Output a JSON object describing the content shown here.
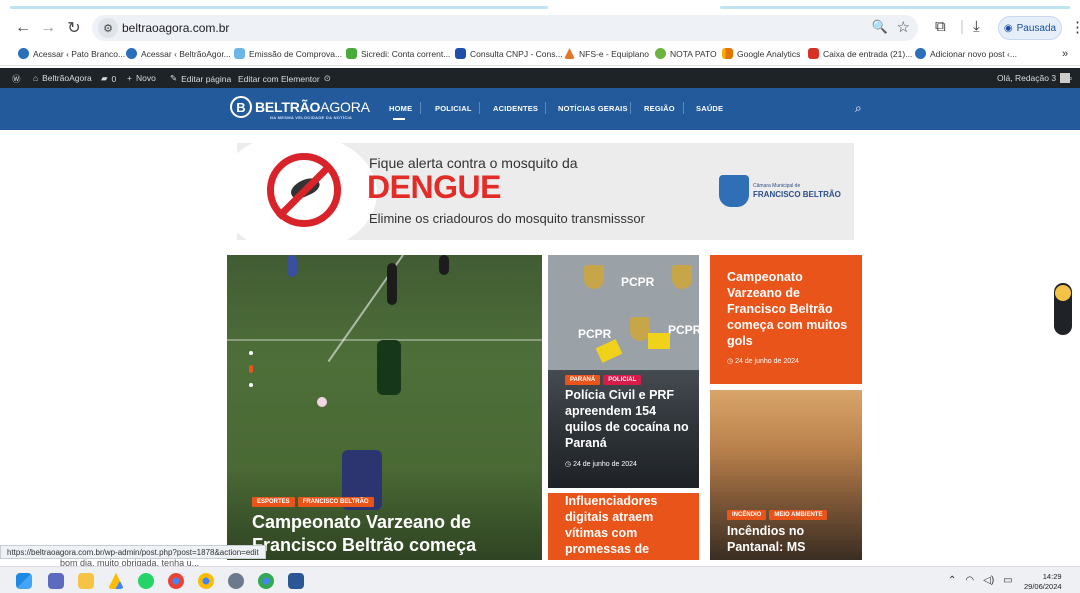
{
  "browser": {
    "url": "beltraoagora.com.br",
    "profile_label": "Pausada",
    "bookmarks": [
      "Acessar ‹ Pato Branco...",
      "Acessar ‹ BeltrãoAgor...",
      "Emissão de Comprova...",
      "Sicredi: Conta corrent...",
      "Consulta CNPJ - Cons...",
      "NFS-e - Equiplano",
      "NOTA PATO",
      "Google Analytics",
      "Caixa de entrada (21)...",
      "Adicionar novo post ‹..."
    ],
    "more_bookmarks": "»"
  },
  "wpbar": {
    "site_name": "BeltrãoAgora",
    "comments_count": "0",
    "new_label": "Novo",
    "edit_page": "Editar página",
    "edit_elementor": "Editar com Elementor",
    "greeting": "Olá, Redação 3"
  },
  "site": {
    "logo_main": "BELTRÃO",
    "logo_second": "AGORA",
    "logo_tagline": "NA MESMA VELOCIDADE DA NOTÍCIA",
    "nav": [
      "HOME",
      "POLICIAL",
      "ACIDENTES",
      "NOTÍCIAS GERAIS",
      "REGIÃO",
      "SAÚDE"
    ]
  },
  "banner": {
    "line1": "Fique alerta contra o mosquito da",
    "line2": "DENGUE",
    "line3": "Elimine os criadouros do mosquito transmisssor",
    "seal_small": "Câmara Municipal de",
    "seal_big": "FRANCISCO BELTRÃO"
  },
  "cards": {
    "main": {
      "tags": [
        "ESPORTES",
        "FRANCISCO BELTRÃO"
      ],
      "title": "Campeonato Varzeano de Francisco Beltrão começa"
    },
    "police": {
      "tags": [
        "PARANÁ",
        "POLICIAL"
      ],
      "title": "Polícia Civil e PRF apreendem 154 quilos de cocaína no Paraná",
      "date": "24 de junho de 2024",
      "wall_text": "PCPR"
    },
    "influ": {
      "title": "Influenciadores digitais atraem vítimas com promessas de"
    },
    "varzeano2": {
      "title": "Campeonato Varzeano de Francisco Beltrão começa com muitos gols",
      "date": "24 de junho de 2024"
    },
    "fire": {
      "tags": [
        "INCÊNDIO",
        "MEIO AMBIENTE"
      ],
      "title": "Incêndios no Pantanal: MS"
    }
  },
  "status_url": "https://beltraoagora.com.br/wp-admin/post.php?post=1878&action=edit",
  "comment_peek": "bom dia, muito obrigada, tenha u...",
  "taskbar": {
    "time": "14:29",
    "date": "29/06/2024"
  },
  "colors": {
    "brand_blue": "#225a9c",
    "accent_orange": "#e8541a",
    "tag_red": "#d81c4a",
    "dengue_red": "#e32b28"
  }
}
